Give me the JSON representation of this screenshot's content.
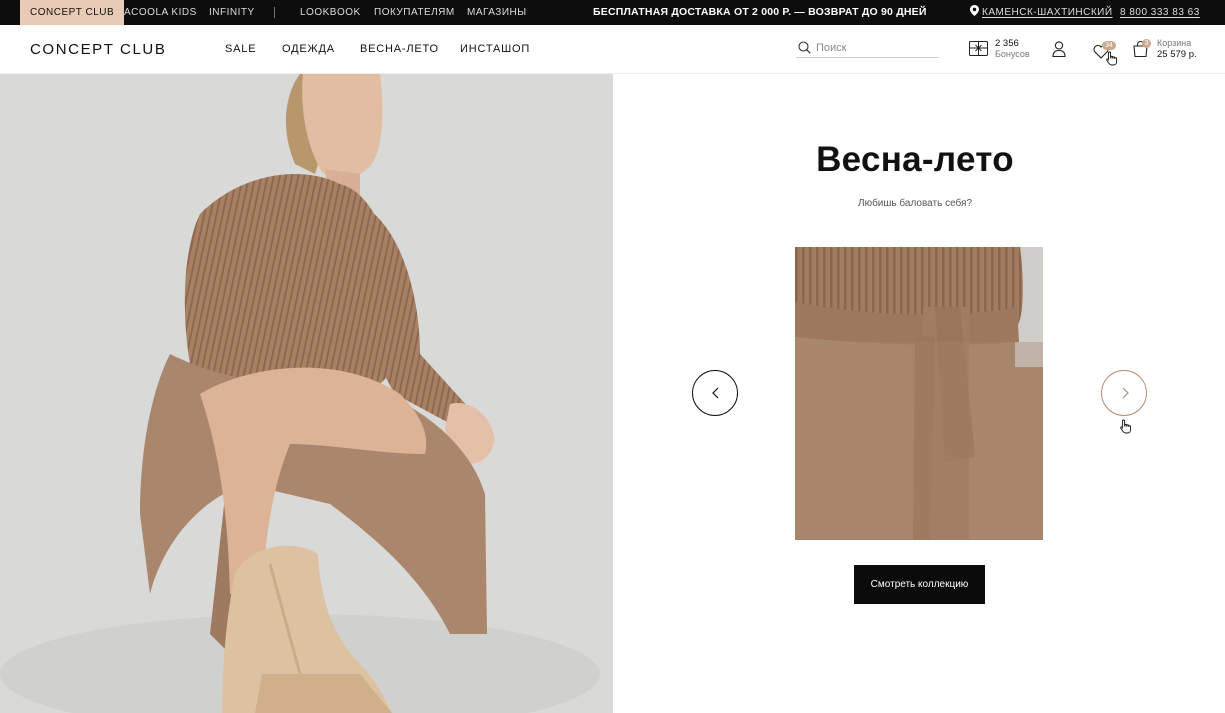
{
  "topbar": {
    "brands": [
      "CONCEPT CLUB",
      "ACOOLA KIDS",
      "INFINITY"
    ],
    "links": [
      "LOOKBOOK",
      "ПОКУПАТЕЛЯМ",
      "МАГАЗИНЫ"
    ],
    "promo": "БЕСПЛАТНАЯ ДОСТАВКА ОТ 2 000 Р. — ВОЗВРАТ ДО 90 ДНЕЙ",
    "city": "КАМЕНСК-ШАХТИНСКИЙ",
    "phone": "8 800 333 83 63"
  },
  "header": {
    "logo": "CONCEPT CLUB",
    "nav": [
      "SALE",
      "ОДЕЖДА",
      "ВЕСНА-ЛЕТО",
      "ИНСТАШОП"
    ],
    "search_placeholder": "Поиск",
    "bonus_value": "2 356",
    "bonus_label": "Бонусов",
    "favorites_count": "34",
    "cart_count": "3",
    "cart_label": "Корзина",
    "cart_sum": "25 579 р."
  },
  "promo_block": {
    "title": "Весна-лето",
    "subtitle": "Любишь баловать себя?",
    "cta": "Смотреть коллекцию"
  },
  "colors": {
    "accent_tab": "#e7cbb6",
    "topbar_bg": "#0d0d0d",
    "badge": "#c9a98e",
    "knit": "#a67e62"
  },
  "icons": [
    "location-pin-icon",
    "search-icon",
    "gift-card-icon",
    "user-icon",
    "heart-icon",
    "bag-icon",
    "chevron-left-icon",
    "chevron-right-icon",
    "pointer-cursor-icon"
  ]
}
